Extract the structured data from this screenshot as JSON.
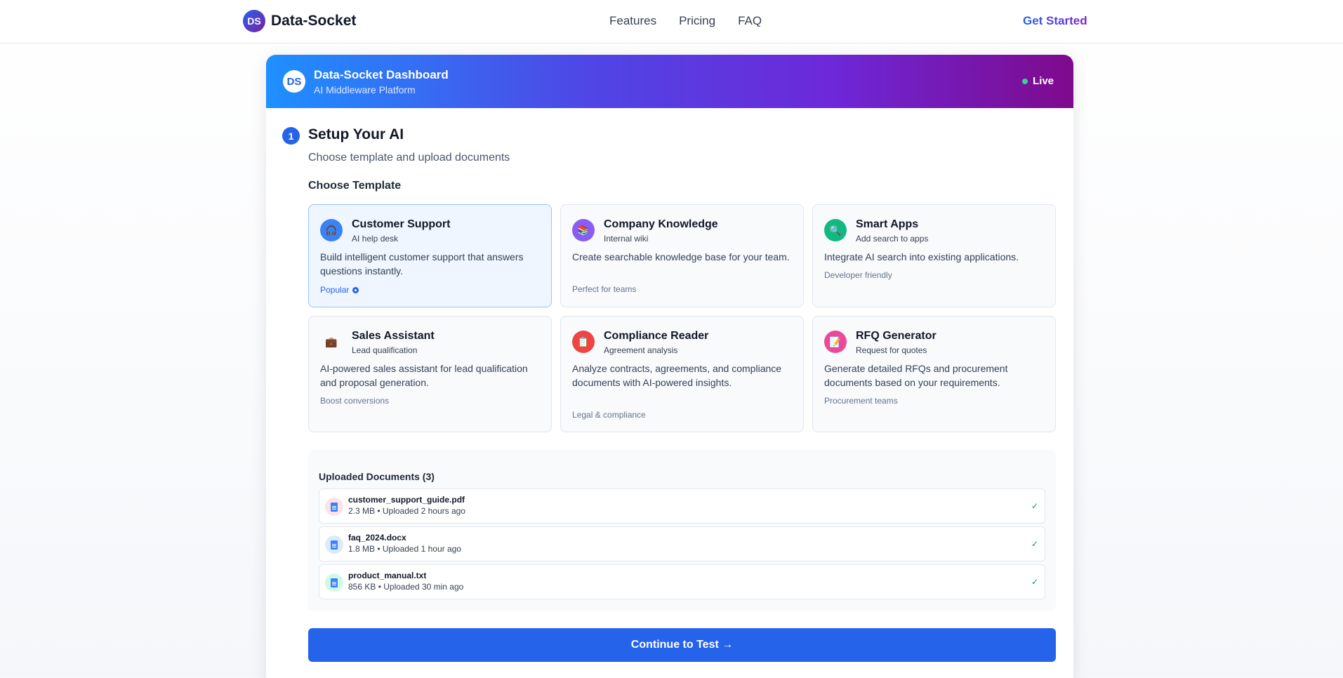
{
  "nav": {
    "logo_text": "DS",
    "brand": "Data-Socket",
    "links": [
      "Features",
      "Pricing",
      "FAQ"
    ],
    "cta": "Get Started"
  },
  "dashboard": {
    "badge": "DS",
    "title": "Data-Socket Dashboard",
    "subtitle": "AI Middleware Platform",
    "status": "Live",
    "status_color": "#34d399",
    "accent": "#2563eb"
  },
  "step": {
    "number": "1",
    "title": "Setup Your AI",
    "subtitle": "Choose template and upload documents",
    "choose_label": "Choose Template"
  },
  "templates": [
    {
      "title": "Customer Support",
      "subtitle": "AI help desk",
      "description": "Build intelligent customer support that answers questions instantly.",
      "footer": "Popular",
      "icon": "headset-icon",
      "glyph": "🎧",
      "color": "#3b82f6",
      "selected": true
    },
    {
      "title": "Company Knowledge",
      "subtitle": "Internal wiki",
      "description": "Create searchable knowledge base for your team.",
      "footer": "Perfect for teams",
      "icon": "book-icon",
      "glyph": "📚",
      "color": "#8b5cf6",
      "selected": false
    },
    {
      "title": "Smart Apps",
      "subtitle": "Add search to apps",
      "description": "Integrate AI search into existing applications.",
      "footer": "Developer friendly",
      "icon": "search-icon",
      "glyph": "🔍",
      "color": "#10b981",
      "selected": false
    },
    {
      "title": "Sales Assistant",
      "subtitle": "Lead qualification",
      "description": "AI-powered sales assistant for lead qualification and proposal generation.",
      "footer": "Boost conversions",
      "icon": "briefcase-icon",
      "glyph": "💼",
      "color": "#f8fafc",
      "selected": false
    },
    {
      "title": "Compliance Reader",
      "subtitle": "Agreement analysis",
      "description": "Analyze contracts, agreements, and compliance documents with AI-powered insights.",
      "footer": "Legal & compliance",
      "icon": "clipboard-icon",
      "glyph": "📋",
      "color": "#ef4444",
      "selected": false
    },
    {
      "title": "RFQ Generator",
      "subtitle": "Request for quotes",
      "description": "Generate detailed RFQs and procurement documents based on your requirements.",
      "footer": "Procurement teams",
      "icon": "memo-icon",
      "glyph": "📝",
      "color": "#ec4899",
      "selected": false
    }
  ],
  "uploads": {
    "title": "Uploaded Documents (3)",
    "files": [
      {
        "name": "customer_support_guide.pdf",
        "meta": "2.3 MB • Uploaded 2 hours ago",
        "icon": "pdf-file-icon",
        "bg": "#fde2e7",
        "status": "✓"
      },
      {
        "name": "faq_2024.docx",
        "meta": "1.8 MB • Uploaded 1 hour ago",
        "icon": "doc-file-icon",
        "bg": "#dbeafe",
        "status": "✓"
      },
      {
        "name": "product_manual.txt",
        "meta": "856 KB • Uploaded 30 min ago",
        "icon": "txt-file-icon",
        "bg": "#d1fae5",
        "status": "✓"
      }
    ]
  },
  "continue_label": "Continue to Test →"
}
